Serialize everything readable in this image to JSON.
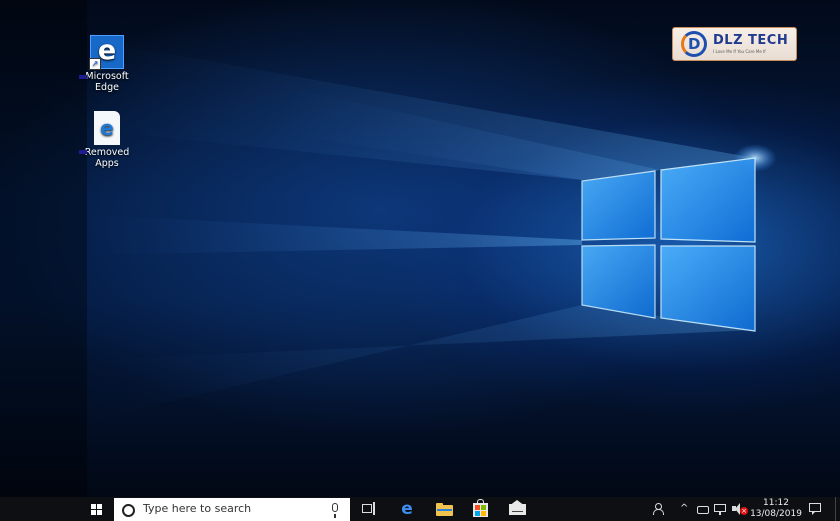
{
  "desktop": {
    "icons": [
      {
        "label_line1": "Microsoft",
        "label_line2": "Edge",
        "icon": "edge-icon",
        "glyph": "e",
        "shortcut_glyph": "↗"
      },
      {
        "label_line1": "Removed",
        "label_line2": "Apps",
        "icon": "document-edge-icon",
        "glyph": "e"
      }
    ],
    "watermark": {
      "brand": "DLZ TECH",
      "tagline": "I Love Me If You Care Me If",
      "logo_letter": "D"
    }
  },
  "taskbar": {
    "search_placeholder": "Type here to search",
    "pinned": [
      "task-view-icon",
      "edge-icon",
      "file-explorer-icon",
      "store-icon",
      "mail-icon"
    ],
    "edge_glyph": "e",
    "tray": {
      "chevron": "^",
      "icons": [
        "people-icon",
        "battery-icon",
        "network-icon",
        "volume-muted-icon"
      ],
      "time": "11:12",
      "date": "13/08/2019"
    }
  },
  "colors": {
    "accent": "#1768c7",
    "taskbar": "#0e0f12"
  }
}
